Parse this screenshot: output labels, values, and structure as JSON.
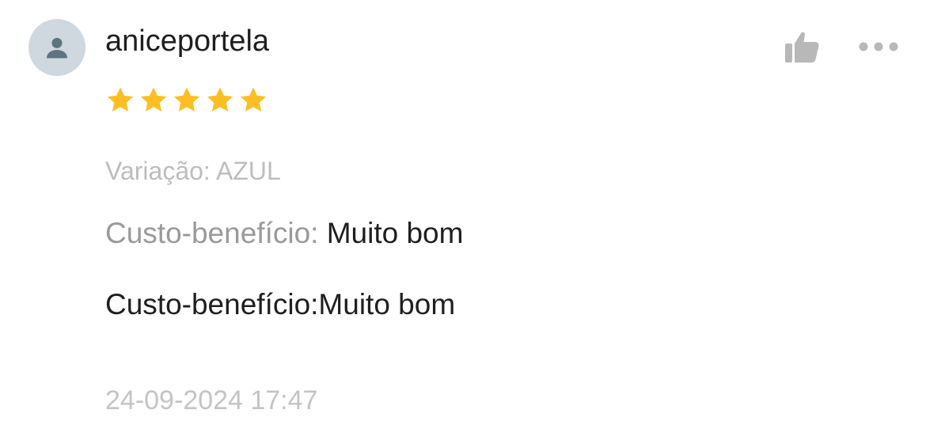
{
  "review": {
    "avatar_icon": "person-icon",
    "username": "aniceportela",
    "rating": 5,
    "rating_max": 5,
    "star_color": "#FBBF24",
    "variation": "Variação: AZUL",
    "attribute": {
      "label": "Custo-benefício: ",
      "value": "Muito bom"
    },
    "comment": "Custo-benefício:Muito bom",
    "timestamp": "24-09-2024 17:47"
  },
  "actions": {
    "like_icon": "thumbs-up-icon",
    "more_icon": "more-options-icon"
  },
  "colors": {
    "avatar_bg": "#CFD8DF",
    "avatar_fg": "#5F7380",
    "icon_gray": "#B8B8B8",
    "muted_text": "#9A9A9A"
  }
}
